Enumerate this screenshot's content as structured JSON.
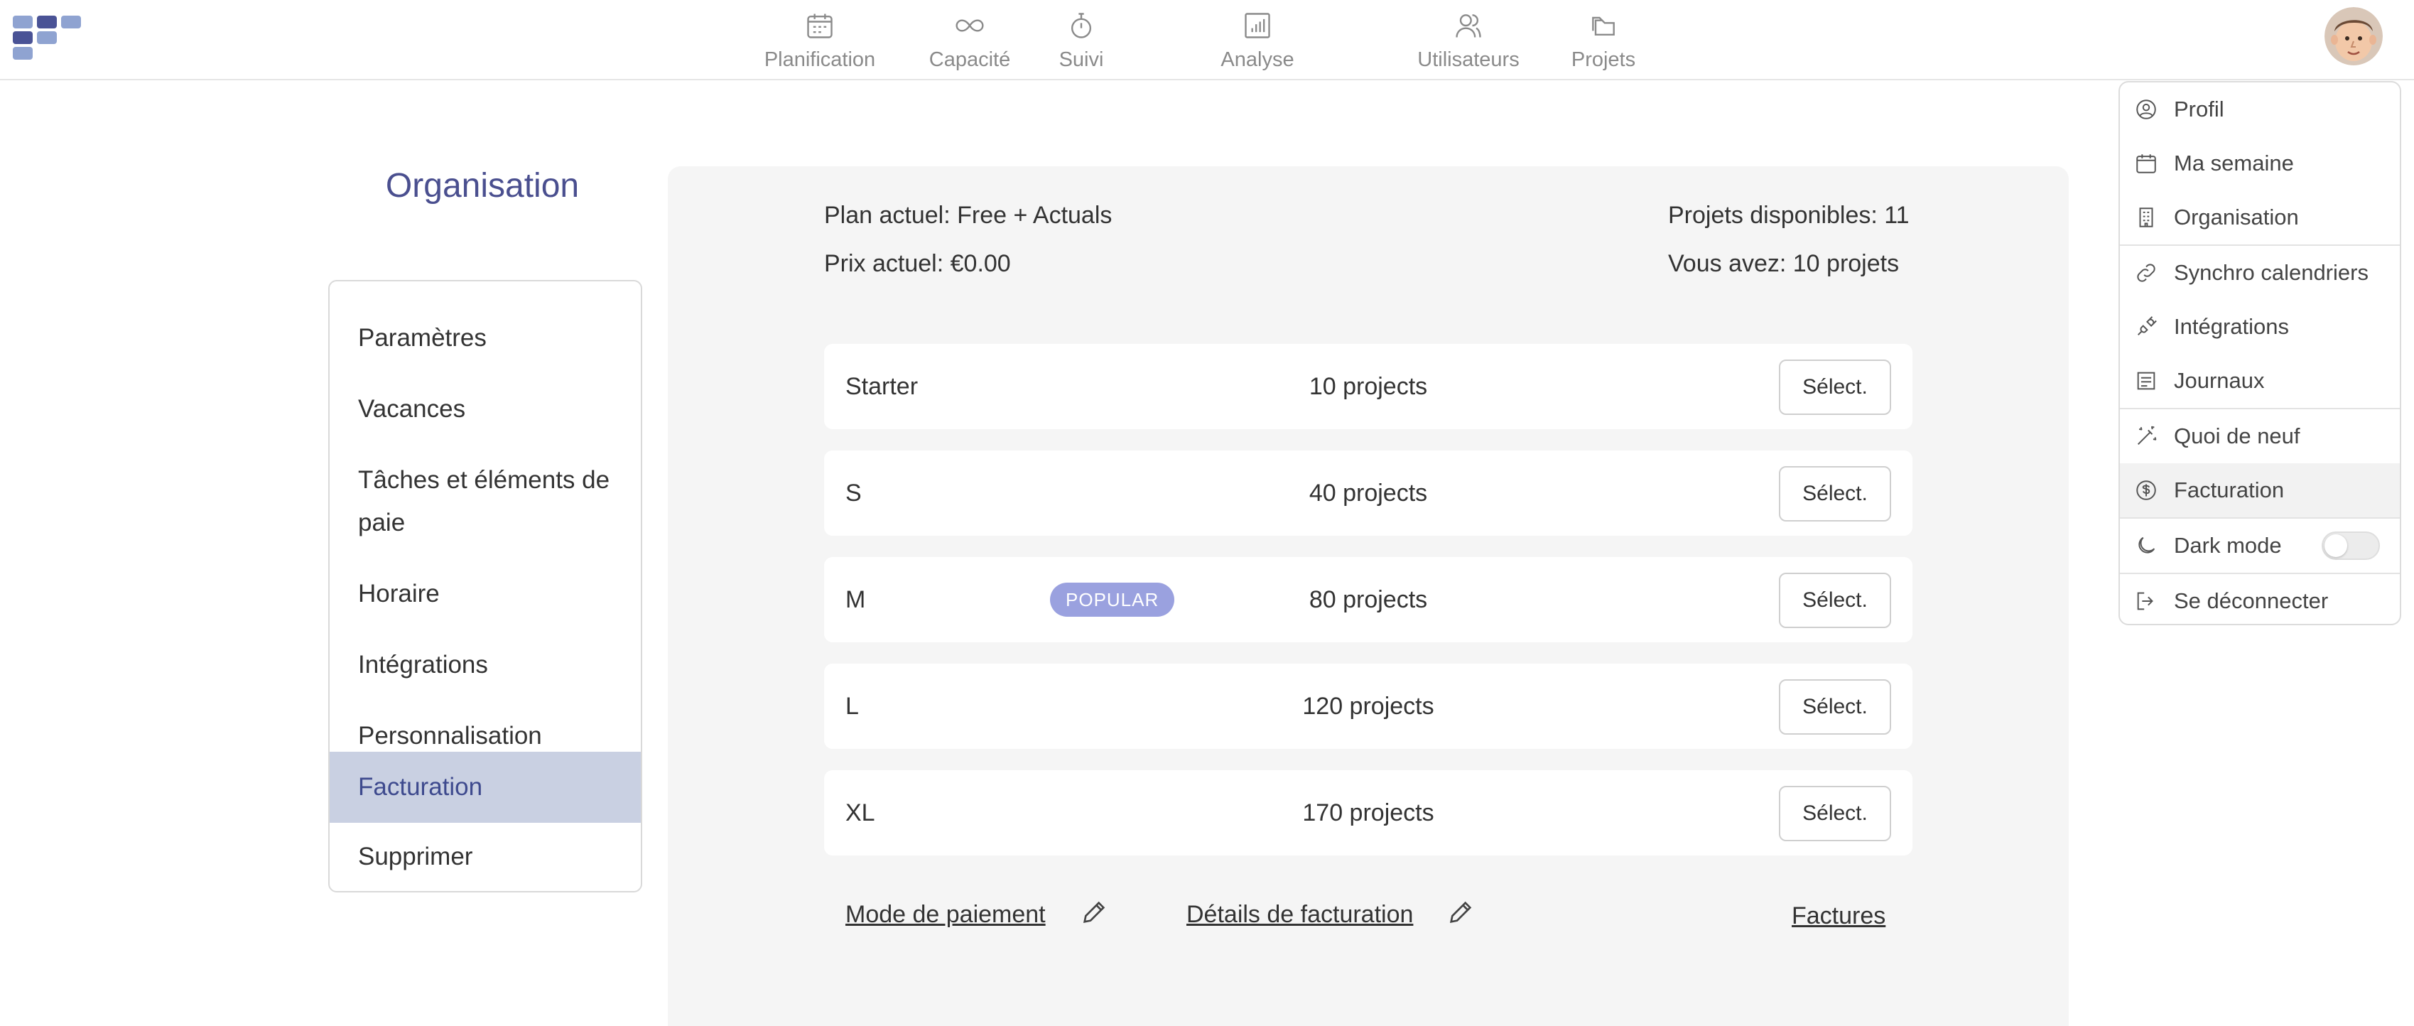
{
  "nav": {
    "items": [
      {
        "label": "Planification",
        "icon": "calendar-icon"
      },
      {
        "label": "Capacité",
        "icon": "infinity-icon"
      },
      {
        "label": "Suivi",
        "icon": "stopwatch-icon"
      },
      {
        "label": "Analyse",
        "icon": "bar-chart-icon"
      },
      {
        "label": "Utilisateurs",
        "icon": "users-icon"
      },
      {
        "label": "Projets",
        "icon": "folders-icon"
      }
    ]
  },
  "sidebar": {
    "title": "Organisation",
    "items": [
      {
        "label": "Paramètres"
      },
      {
        "label": "Vacances"
      },
      {
        "label": "Tâches et éléments de paie"
      },
      {
        "label": "Horaire"
      },
      {
        "label": "Intégrations"
      },
      {
        "label": "Personnalisation"
      },
      {
        "label": "Facturation"
      },
      {
        "label": "Supprimer"
      }
    ],
    "active": "Facturation"
  },
  "billing": {
    "current_plan": "Plan actuel: Free + Actuals",
    "current_price": "Prix actuel: €0.00",
    "available_projects": "Projets disponibles: 11",
    "you_have": "Vous avez: 10 projets",
    "plans": [
      {
        "name": "Starter",
        "projects": "10 projects",
        "button": "Sélect."
      },
      {
        "name": "S",
        "projects": "40 projects",
        "button": "Sélect."
      },
      {
        "name": "M",
        "projects": "80 projects",
        "button": "Sélect.",
        "badge": "POPULAR"
      },
      {
        "name": "L",
        "projects": "120 projects",
        "button": "Sélect."
      },
      {
        "name": "XL",
        "projects": "170 projects",
        "button": "Sélect."
      }
    ],
    "payment_method": "Mode de paiement",
    "billing_details": "Détails de facturation",
    "invoices": "Factures"
  },
  "dropdown": {
    "items": [
      {
        "label": "Profil",
        "icon": "user-circle-icon"
      },
      {
        "label": "Ma semaine",
        "icon": "calendar-icon"
      },
      {
        "label": "Organisation",
        "icon": "building-icon"
      },
      {
        "label": "Synchro calendriers",
        "icon": "link-icon"
      },
      {
        "label": "Intégrations",
        "icon": "plug-icon"
      },
      {
        "label": "Journaux",
        "icon": "log-icon"
      },
      {
        "label": "Quoi de neuf",
        "icon": "magic-wand-icon"
      },
      {
        "label": "Facturation",
        "icon": "dollar-circle-icon"
      },
      {
        "label": "Dark mode",
        "icon": "moon-icon"
      },
      {
        "label": "Se déconnecter",
        "icon": "logout-icon"
      }
    ],
    "active": "Facturation",
    "dark_mode_on": false
  },
  "colors": {
    "accent": "#4a4f8f",
    "active_bg": "#c9d0e2",
    "badge": "#9aa1df",
    "panel_bg": "#f5f5f5"
  }
}
